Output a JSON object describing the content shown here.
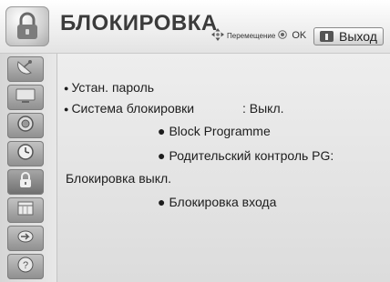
{
  "header": {
    "title": "БЛОКИРОВКА",
    "move_hint": "Перемещение",
    "ok_hint": "OK",
    "exit_label": "Выход"
  },
  "sidebar": {
    "items": [
      {
        "icon": "satellite-dish-icon"
      },
      {
        "icon": "tv-picture-icon"
      },
      {
        "icon": "speaker-audio-icon"
      },
      {
        "icon": "clock-icon"
      },
      {
        "icon": "lock-icon",
        "active": true
      },
      {
        "icon": "calendar-option-icon"
      },
      {
        "icon": "input-source-icon"
      },
      {
        "icon": "help-icon"
      }
    ]
  },
  "menu": {
    "set_password": "Устан. пароль",
    "lock_system_label": "Система блокировки",
    "lock_system_value": ": Выкл.",
    "block_programme": "Block Programme",
    "parental_control": "Родительский контроль PG:",
    "parental_status": "Блокировка выкл.",
    "input_block": "Блокировка входа"
  }
}
